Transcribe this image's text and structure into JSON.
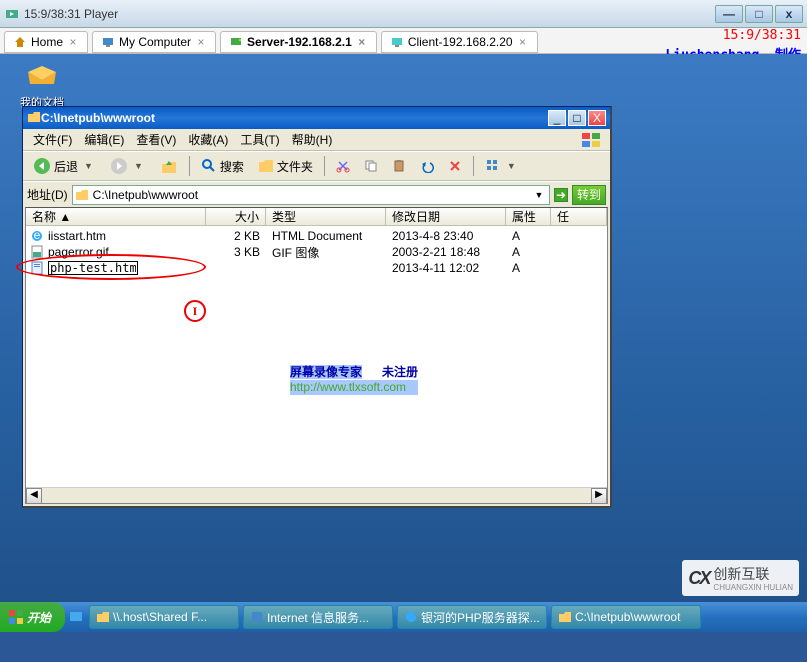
{
  "player": {
    "title": "15:9/38:31 Player",
    "time_overlay": "15:9/38:31",
    "signature": "Liuchenchang--制作"
  },
  "host_tabs": [
    {
      "label": "Home",
      "icon": "home-icon"
    },
    {
      "label": "My Computer",
      "icon": "computer-icon"
    },
    {
      "label": "Server-192.168.2.1",
      "icon": "server-icon",
      "active": true
    },
    {
      "label": "Client-192.168.2.20",
      "icon": "client-icon"
    }
  ],
  "desktop_icon_label": "我的文档",
  "explorer": {
    "title": "C:\\Inetpub\\wwwroot",
    "menu": {
      "file": "文件(F)",
      "edit": "编辑(E)",
      "view": "查看(V)",
      "fav": "收藏(A)",
      "tools": "工具(T)",
      "help": "帮助(H)"
    },
    "toolbar": {
      "back": "后退",
      "search": "搜索",
      "folders": "文件夹"
    },
    "addressbar": {
      "label": "地址(D)",
      "path": "C:\\Inetpub\\wwwroot",
      "go": "转到"
    },
    "columns": {
      "name": "名称",
      "size": "大小",
      "type": "类型",
      "modified": "修改日期",
      "attr": "属性",
      "task": "任"
    },
    "files": [
      {
        "icon": "ie",
        "name": "iisstart.htm",
        "size": "2 KB",
        "type": "HTML Document",
        "modified": "2013-4-8 23:40",
        "attr": "A"
      },
      {
        "icon": "gif",
        "name": "pagerror.gif",
        "size": "3 KB",
        "type": "GIF 图像",
        "modified": "2003-2-21 18:48",
        "attr": "A"
      }
    ],
    "editing_file": {
      "value": "php-test.htm",
      "size": "",
      "type": "",
      "modified": "2013-4-11 12:02",
      "attr": "A"
    },
    "watermark": {
      "line1a": "屏幕录像专家",
      "line1b": "未注册",
      "line2": "http://www.tlxsoft.com"
    }
  },
  "taskbar": {
    "start": "开始",
    "buttons": [
      "\\\\.host\\Shared F...",
      "Internet 信息服务...",
      "银河的PHP服务器探...",
      "C:\\Inetpub\\wwwroot"
    ]
  },
  "logo": {
    "cx": "CX",
    "txt": "创新互联",
    "sub": "CHUANGXIN HULIAN"
  }
}
